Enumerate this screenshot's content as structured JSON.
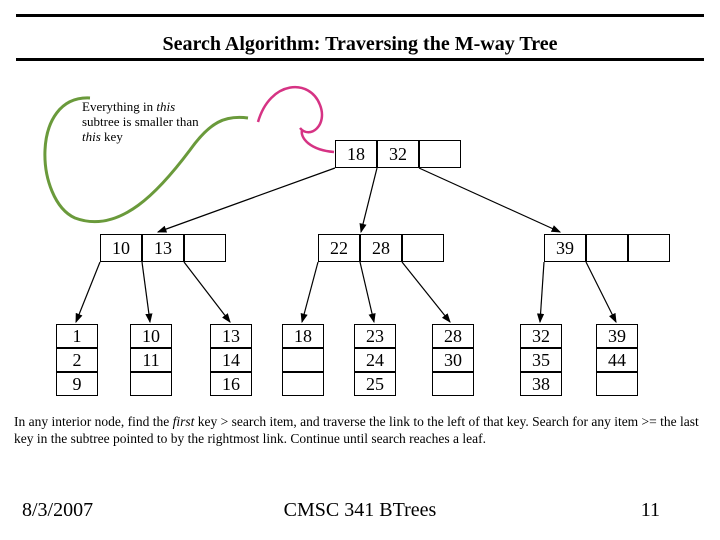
{
  "title": "Search Algorithm: Traversing the M-way Tree",
  "annotation": {
    "line1": "Everything in ",
    "line1_italic": "this",
    "line2": "subtree is smaller than",
    "line3_italic": "this",
    "line3_rest": " key"
  },
  "root": {
    "keys": [
      "18",
      "32"
    ]
  },
  "mid": [
    {
      "keys": [
        "10",
        "13"
      ]
    },
    {
      "keys": [
        "22",
        "28"
      ]
    },
    {
      "keys": [
        "39"
      ]
    }
  ],
  "leaves": [
    [
      "1",
      "2",
      "9"
    ],
    [
      "10",
      "11"
    ],
    [
      "13",
      "14",
      "16"
    ],
    [
      "18"
    ],
    [
      "23",
      "24",
      "25"
    ],
    [
      "28",
      "30"
    ],
    [
      "32",
      "35",
      "38"
    ],
    [
      "39",
      "44"
    ]
  ],
  "explain": "In any interior node, find the first key > search item, and traverse the link to the left of that key. Search for any item >= the last key in the subtree pointed to by the rightmost link. Continue until search reaches a leaf.",
  "explain_italic_word": "first",
  "footer": {
    "date": "8/3/2007",
    "center": "CMSC 341 BTrees",
    "page": "11"
  }
}
